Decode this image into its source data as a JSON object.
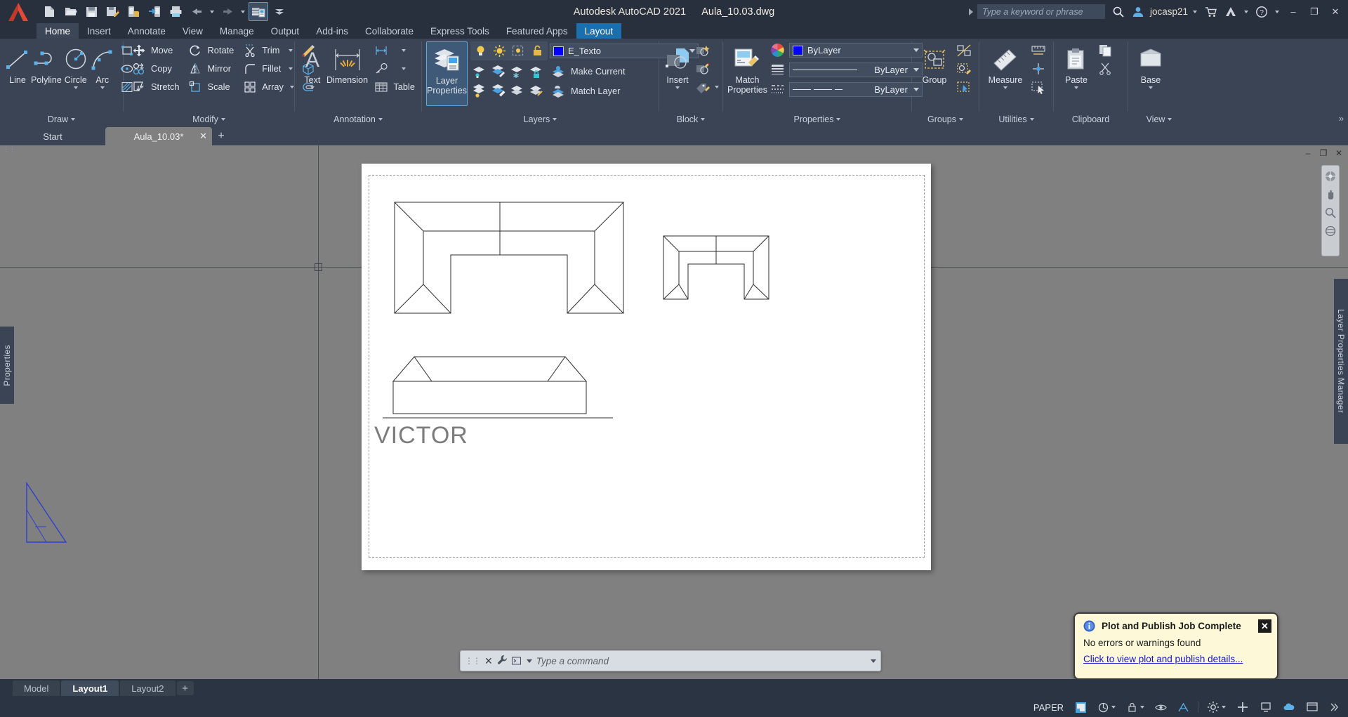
{
  "window": {
    "app_title": "Autodesk AutoCAD 2021",
    "file_name": "Aula_10.03.dwg",
    "minimize": "–",
    "maximize": "❐",
    "close": "✕"
  },
  "quick_access": {
    "items": [
      {
        "name": "new-file-icon",
        "label": "New"
      },
      {
        "name": "open-file-icon",
        "label": "Open"
      },
      {
        "name": "save-icon",
        "label": "Save"
      },
      {
        "name": "save-as-icon",
        "label": "Save As"
      },
      {
        "name": "save-to-web-icon",
        "label": "Save to Web & Mobile"
      },
      {
        "name": "open-from-web-icon",
        "label": "Open from Web & Mobile"
      },
      {
        "name": "plot-icon",
        "label": "Plot"
      },
      {
        "name": "undo-icon",
        "label": "Undo"
      },
      {
        "name": "redo-icon",
        "label": "Redo"
      },
      {
        "name": "workspace-icon",
        "label": "Workspace Switching"
      },
      {
        "name": "customize-qat-icon",
        "label": "Customize Quick Access Toolbar"
      }
    ]
  },
  "search": {
    "placeholder": "Type a keyword or phrase",
    "search_icon": "search-icon"
  },
  "account": {
    "user": "jocasp21",
    "avatar": "user-avatar-icon",
    "dropdown_caret": "chevron-down-icon",
    "cart_icon": "cart-icon",
    "autodesk_icon": "autodesk-app-icon",
    "help_icon": "help-icon"
  },
  "ribbon": {
    "tabs": [
      {
        "label": "Home",
        "state": "selected"
      },
      {
        "label": "Insert",
        "state": "normal"
      },
      {
        "label": "Annotate",
        "state": "normal"
      },
      {
        "label": "View",
        "state": "normal"
      },
      {
        "label": "Manage",
        "state": "normal"
      },
      {
        "label": "Output",
        "state": "normal"
      },
      {
        "label": "Add-ins",
        "state": "normal"
      },
      {
        "label": "Collaborate",
        "state": "normal"
      },
      {
        "label": "Express Tools",
        "state": "normal"
      },
      {
        "label": "Featured Apps",
        "state": "normal"
      },
      {
        "label": "Layout",
        "state": "highlighted"
      }
    ],
    "panels": {
      "draw": {
        "title": "Draw",
        "buttons": [
          {
            "label": "Line",
            "icon": "line-icon"
          },
          {
            "label": "Polyline",
            "icon": "polyline-icon"
          },
          {
            "label": "Circle",
            "icon": "circle-icon"
          },
          {
            "label": "Arc",
            "icon": "arc-icon"
          }
        ],
        "flyouts": [
          {
            "icon": "rectangle-icon"
          },
          {
            "icon": "ellipse-icon"
          },
          {
            "icon": "hatch-icon"
          }
        ]
      },
      "modify": {
        "title": "Modify",
        "column1": [
          {
            "label": "Move",
            "icon": "move-icon"
          },
          {
            "label": "Copy",
            "icon": "copy-icon"
          },
          {
            "label": "Stretch",
            "icon": "stretch-icon"
          }
        ],
        "column2": [
          {
            "label": "Rotate",
            "icon": "rotate-icon"
          },
          {
            "label": "Mirror",
            "icon": "mirror-icon"
          },
          {
            "label": "Scale",
            "icon": "scale-icon"
          }
        ],
        "column3": [
          {
            "label": "Trim",
            "icon": "trim-icon"
          },
          {
            "label": "Fillet",
            "icon": "fillet-icon"
          },
          {
            "label": "Array",
            "icon": "array-icon"
          }
        ],
        "column4": [
          {
            "icon": "explode-icon"
          },
          {
            "icon": "solid-edit-icon"
          },
          {
            "icon": "offset-icon"
          }
        ]
      },
      "annotation": {
        "title": "Annotation",
        "text": {
          "label": "Text",
          "icon": "text-icon"
        },
        "dimension": {
          "label": "Dimension",
          "icon": "dimension-icon"
        },
        "linear": {
          "icon": "linear-dimension-icon"
        },
        "leader": {
          "icon": "leader-icon"
        },
        "table": {
          "label": "Table",
          "icon": "table-icon"
        }
      },
      "layers": {
        "title": "Layers",
        "layer_properties": {
          "label_line1": "Layer",
          "label_line2": "Properties",
          "icon": "layer-properties-icon"
        },
        "current_layer": "E_Texto",
        "layer_color": "#0000ff",
        "make_current": {
          "label": "Make Current",
          "icon": "make-current-icon"
        },
        "match_layer": {
          "label": "Match Layer",
          "icon": "match-layer-icon"
        },
        "state_icons": [
          "layer-on-icon",
          "layer-thaw-icon",
          "layer-vp-freeze-icon",
          "layer-unlock-icon"
        ],
        "tool_icons": [
          "layer-isolate-icon",
          "layer-unisolate-icon",
          "layer-freeze-icon",
          "layer-lock-icon",
          "layer-off-icon",
          "layer-turn-all-on-icon",
          "layer-merge-icon",
          "layer-delete-icon",
          "layer-previous-icon"
        ]
      },
      "block": {
        "title": "Block",
        "insert": {
          "label": "Insert",
          "icon": "insert-block-icon"
        },
        "tools": [
          "create-block-icon",
          "edit-block-icon",
          "block-attributes-icon"
        ]
      },
      "properties": {
        "title": "Properties",
        "match_properties": {
          "label_line1": "Match",
          "label_line2": "Properties",
          "icon": "match-properties-icon"
        },
        "color": {
          "value": "ByLayer",
          "swatch": "#0000ff",
          "icon": "color-wheel-icon"
        },
        "lineweight": {
          "value": "ByLayer",
          "icon": "lineweight-icon"
        },
        "linetype": {
          "value": "ByLayer",
          "icon": "linetype-icon"
        }
      },
      "groups": {
        "title": "Groups",
        "group": {
          "label": "Group",
          "icon": "group-icon"
        },
        "tools": [
          "ungroup-icon",
          "group-edit-icon",
          "group-selection-icon"
        ]
      },
      "utilities": {
        "title": "Utilities",
        "measure": {
          "label": "Measure",
          "icon": "measure-icon"
        },
        "tools": [
          "quick-measure-icon",
          "id-point-icon",
          "quick-select-icon"
        ]
      },
      "clipboard": {
        "title": "Clipboard",
        "paste": {
          "label": "Paste",
          "icon": "paste-icon"
        },
        "tools": [
          "copy-clip-icon",
          "cut-clip-icon"
        ]
      },
      "view": {
        "title": "View",
        "base": {
          "label": "Base",
          "icon": "base-view-icon"
        }
      }
    }
  },
  "document_tabs": {
    "items": [
      {
        "label": "Start",
        "active": false,
        "closable": false
      },
      {
        "label": "Aula_10.03*",
        "active": true,
        "closable": true
      }
    ],
    "add_label": "+",
    "close_glyph": "✕"
  },
  "canvas": {
    "paper_title": "VICTOR",
    "properties_palette_label": "Properties",
    "layer_properties_manager_label": "Layer Properties Manager",
    "viewport_controls": {
      "minimize": "–",
      "restore": "❐",
      "close": "✕"
    },
    "nav_tools": [
      "steering-wheel-icon",
      "pan-icon",
      "zoom-extents-icon",
      "orbit-icon"
    ]
  },
  "command_line": {
    "placeholder": "Type a command",
    "close_glyph": "✕",
    "customize_icon": "wrench-icon",
    "grip_icon": "drag-grip-icon",
    "history_icon": "command-history-icon"
  },
  "notification": {
    "title": "Plot and Publish Job Complete",
    "body": "No errors or warnings found",
    "link": "Click to view plot and publish details...",
    "close_glyph": "✕",
    "info_icon": "info-icon"
  },
  "layout_tabs": {
    "items": [
      {
        "label": "Model",
        "active": false
      },
      {
        "label": "Layout1",
        "active": true
      },
      {
        "label": "Layout2",
        "active": false
      }
    ],
    "add_label": "+"
  },
  "status_bar": {
    "space_label": "PAPER",
    "items": [
      {
        "name": "model-paper-toggle",
        "icon": "viewport-icon"
      },
      {
        "name": "viewport-scale",
        "icon": "scale-list-icon"
      },
      {
        "name": "viewport-lock",
        "icon": "lock-icon"
      },
      {
        "name": "annotation-visibility",
        "icon": "annotation-visibility-icon"
      },
      {
        "name": "annotation-scale",
        "icon": "annotation-scale-icon"
      },
      {
        "name": "workspace-switching",
        "icon": "gear-icon"
      },
      {
        "name": "customization",
        "icon": "customization-icon"
      },
      {
        "name": "hardware-acceleration",
        "icon": "display-icon"
      },
      {
        "name": "clean-screen",
        "icon": "clean-screen-icon"
      }
    ]
  }
}
